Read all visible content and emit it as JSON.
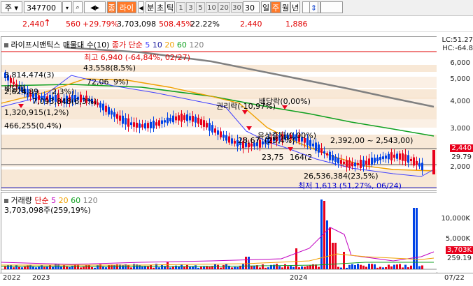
{
  "toolbar": {
    "market_label": "주",
    "code": "347700",
    "btn_price_type": "종",
    "btn_rai": "라이",
    "btn_bun": "분",
    "btn_cho": "초",
    "btn_tik": "틱",
    "intervals": [
      "1",
      "3",
      "5",
      "10",
      "20",
      "30"
    ],
    "interval_selected": "30",
    "btn_day": "일",
    "btn_week": "주",
    "btn_month": "월",
    "btn_year": "년"
  },
  "quote": {
    "price": "2,440",
    "change": "560",
    "change_pct": "+29.79%",
    "volume": "3,703,098",
    "volume_pct": "508.45%",
    "turnover": "22.22%",
    "open": "2,440",
    "low_value": "1,886"
  },
  "price_panel": {
    "title": "라이프시맨틱스 매물대 수(10)",
    "ma_label": "종가 단순",
    "ma_periods": [
      "5",
      "10",
      "20",
      "60",
      "120"
    ],
    "lc_label": "LC:51.27",
    "hc_label": "HC:-64.8",
    "annotations": {
      "high": "최고 6,940 (-64,84%, 02/27)",
      "low": "최저 1,613 (51,27%, 06/24)",
      "vp1": "3,814,474(3)",
      "vp2": "43,558(8,5%)",
      "vp3": "배당락",
      "vp4": "2,624,89",
      "vp5": "2,3%)",
      "vp6": "72,06",
      "vp7": "9%)",
      "vp8": "7,093,848(6,3%)",
      "vp9": "1,320,915(1,2%)",
      "vp10": "466,255(0,4%)",
      "vp11": "배당락(0,00%)",
      "vp12": "권리락(-10,97%)",
      "vp13": "유상증자(0,00%)",
      "vp14": "28,67",
      "vp15": "(25,4%)",
      "vp16": "2,392,00 ~ 2,543,00)",
      "vp17": "23,75",
      "vp18": "164(2",
      "vp19": "26,536,384(23,5%)"
    },
    "y_ticks": [
      "6,000",
      "5,000",
      "4,000",
      "3,000",
      "2,000"
    ],
    "last_tag": "2,440",
    "last_pct": "29.79"
  },
  "volume_panel": {
    "title": "거래량",
    "ma_label": "단순",
    "ma_periods": [
      "5",
      "20",
      "60",
      "120"
    ],
    "value_label": "3,703,098주(259,19%)",
    "y_ticks": [
      "10,000K",
      "5,000K"
    ],
    "last_tag": "3,703K",
    "last_pct": "259.19"
  },
  "x_axis": [
    "2022",
    "2023",
    "2024",
    "07/22"
  ],
  "colors": {
    "up": "#e8001c",
    "down": "#0042e6",
    "ma5": "#4040ff",
    "ma10": "#2020a0",
    "ma20": "#f0a000",
    "ma60": "#10a020",
    "ma120": "#808080",
    "vp_band": "#f7e4cf"
  }
}
